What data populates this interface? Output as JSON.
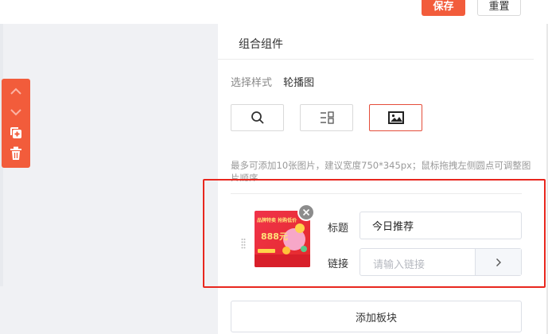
{
  "header": {
    "save_label": "保存",
    "reset_label": "重置"
  },
  "toolbar": {
    "icons": [
      "chevron-up-icon",
      "chevron-down-icon",
      "copy-add-icon",
      "trash-icon"
    ],
    "color": "#f25c3b"
  },
  "panel": {
    "title": "组合组件",
    "style_label": "选择样式",
    "style_value": "轮播图",
    "style_options": [
      "search-icon",
      "grid-list-icon",
      "image-icon"
    ],
    "selected_style": "image-icon",
    "hint": "最多可添加10张图片，建议宽度750*345px；鼠标拖拽左侧圆点可调整图片顺序",
    "item": {
      "thumbnail_text_1": "品牌特卖 抢购低价",
      "thumbnail_text_2": "888元",
      "title_label": "标题",
      "title_value": "今日推荐",
      "link_label": "链接",
      "link_placeholder": "请输入链接"
    },
    "add_block_label": "添加板块"
  },
  "colors": {
    "accent": "#f25c3b",
    "highlight": "#e8271e",
    "active_border": "#e44d3a"
  }
}
